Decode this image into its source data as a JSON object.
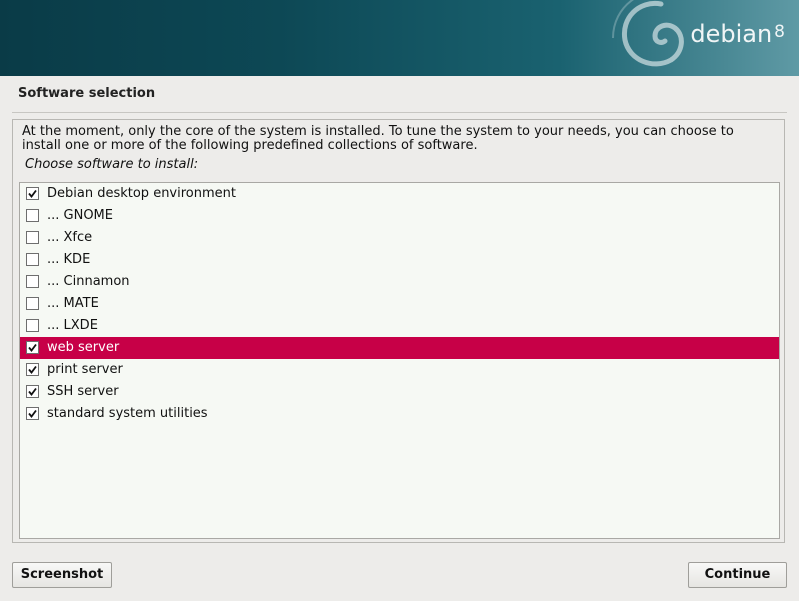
{
  "banner": {
    "brand": "debian",
    "version": "8",
    "icon": "debian-swirl-icon"
  },
  "page": {
    "title": "Software selection",
    "intro": "At the moment, only the core of the system is installed. To tune the system to your needs, you can choose to install one or more of the following predefined collections of software.",
    "prompt": "Choose software to install:"
  },
  "tasks": [
    {
      "label": "Debian desktop environment",
      "checked": true,
      "selected": false
    },
    {
      "label": "... GNOME",
      "checked": false,
      "selected": false
    },
    {
      "label": "... Xfce",
      "checked": false,
      "selected": false
    },
    {
      "label": "... KDE",
      "checked": false,
      "selected": false
    },
    {
      "label": "... Cinnamon",
      "checked": false,
      "selected": false
    },
    {
      "label": "... MATE",
      "checked": false,
      "selected": false
    },
    {
      "label": "... LXDE",
      "checked": false,
      "selected": false
    },
    {
      "label": "web server",
      "checked": true,
      "selected": true
    },
    {
      "label": "print server",
      "checked": true,
      "selected": false
    },
    {
      "label": "SSH server",
      "checked": true,
      "selected": false
    },
    {
      "label": "standard system utilities",
      "checked": true,
      "selected": false
    }
  ],
  "buttons": {
    "screenshot": "Screenshot",
    "continue": "Continue"
  },
  "colors": {
    "banner": "#0d4855",
    "selection": "#c70047",
    "list_background": "#f6f9f4",
    "window_background": "#edecea"
  }
}
